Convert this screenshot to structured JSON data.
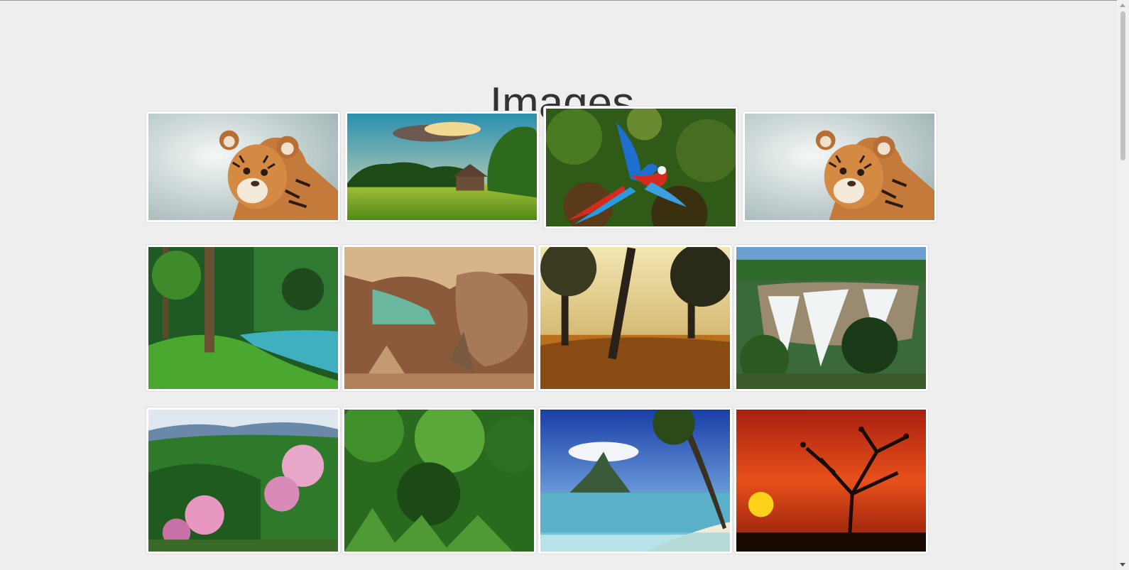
{
  "page": {
    "title": "Images"
  },
  "gallery": {
    "rows": [
      [
        {
          "subject": "tiger-cub"
        },
        {
          "subject": "meadow-cabin"
        },
        {
          "subject": "macaw-parrot"
        },
        {
          "subject": "tiger-cub"
        }
      ],
      [
        {
          "subject": "forest-river"
        },
        {
          "subject": "cave-stalactites"
        },
        {
          "subject": "autumn-woods"
        },
        {
          "subject": "waterfall"
        }
      ],
      [
        {
          "subject": "mountain-flowers"
        },
        {
          "subject": "jungle"
        },
        {
          "subject": "tropical-beach"
        },
        {
          "subject": "sunset-tree-birds"
        }
      ]
    ]
  },
  "theme": {
    "background": "#eeeeee",
    "title_color": "#333333",
    "thumbnail_border": "#dddddd"
  }
}
